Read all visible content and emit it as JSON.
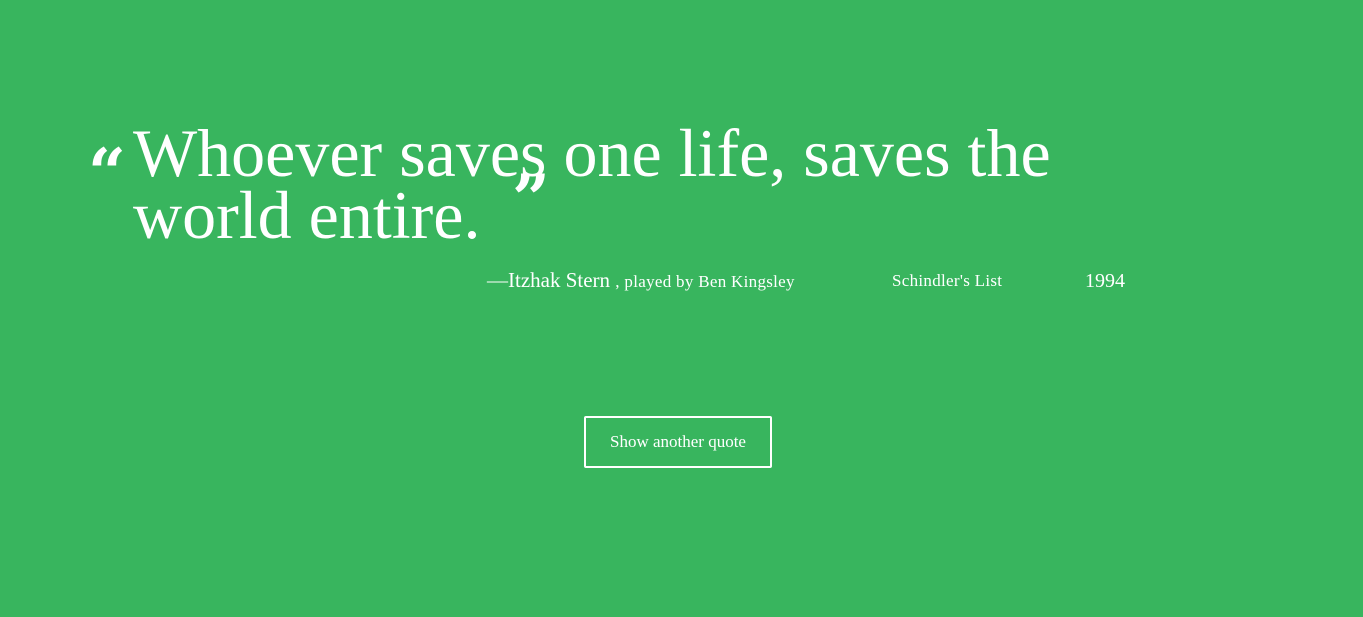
{
  "quote": {
    "open_mark": "“",
    "text": "Whoever saves one life, saves the world entire.",
    "close_mark": "”"
  },
  "attribution": {
    "character": "—Itzhak Stern",
    "actor": ", played by Ben Kingsley",
    "movie": "Schindler's List",
    "year": "1994"
  },
  "actions": {
    "another_label": "Show another quote"
  },
  "colors": {
    "background": "#38b55e",
    "text": "#ffffff"
  }
}
